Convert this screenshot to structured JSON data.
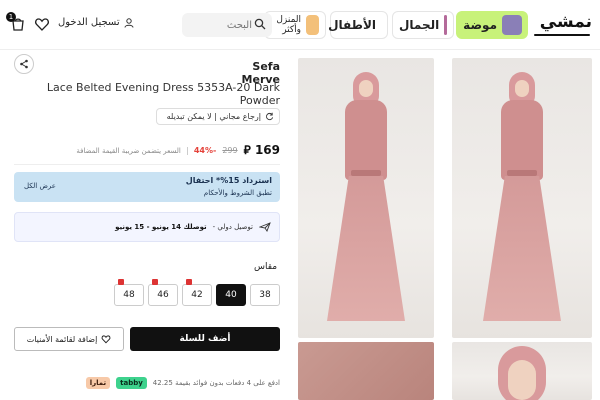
{
  "header": {
    "logo": "نمشي",
    "categories": [
      {
        "label": "موضة",
        "color": "#c8f27a"
      },
      {
        "label": "الجمال"
      },
      {
        "label": "الأطفال"
      },
      {
        "label": "المنزل وأكثر"
      }
    ],
    "search": {
      "placeholder": "البحث"
    },
    "login_label": "تسجيل الدخول",
    "cart_count": "1"
  },
  "product": {
    "brand": "Sefa Merve",
    "title": "Lace Belted Evening Dress 5353A-20 Dark Powder",
    "return_note": "إرجاع مجاني | لا يمكن تبديله",
    "price": "169",
    "old_price": "299",
    "discount": "-44%",
    "vat_note": "السعر يتضمن ضريبة القيمة المضافة",
    "cashback": {
      "title": "استرداد 15%* احتفال",
      "terms": "تطبق الشروط والأحكام",
      "offer": "عرض الكل"
    },
    "delivery": {
      "label": "توصيل دولي -",
      "date": "توصلك 14 يونيو - 15 يونيو"
    },
    "size_label": "مقاس",
    "sizes": [
      {
        "label": "38",
        "selected": false,
        "low_stock": false
      },
      {
        "label": "40",
        "selected": true,
        "low_stock": false
      },
      {
        "label": "42",
        "selected": false,
        "low_stock": true
      },
      {
        "label": "46",
        "selected": false,
        "low_stock": true
      },
      {
        "label": "48",
        "selected": false,
        "low_stock": true
      }
    ],
    "add_to_cart": "أضف للسلة",
    "wishlist": "إضافة لقائمة الأمنيات",
    "installments": "ادفع على 4 دفعات بدون فوائد بقيمة 42.25",
    "tabby": "tabby",
    "tamara": "تمارا"
  },
  "colors": {
    "accent": "#c8f27a",
    "cashback_bg": "#c9e2f3",
    "discount": "#e4423a",
    "dress": "#d49a99"
  }
}
